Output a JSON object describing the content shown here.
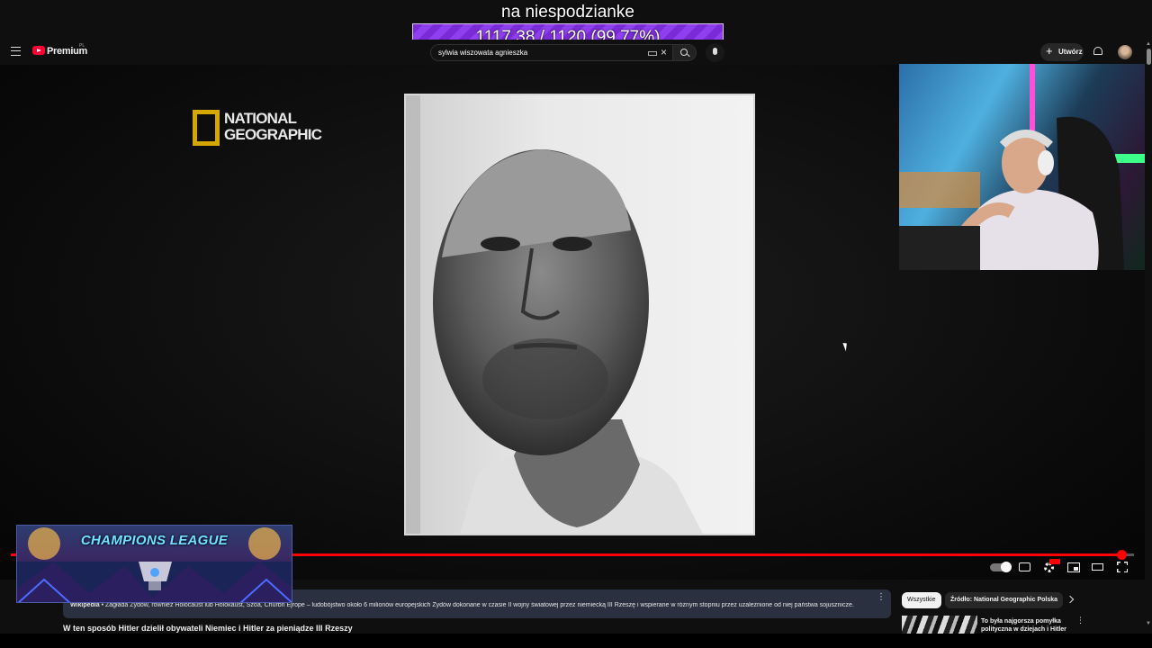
{
  "overlay": {
    "title": "na niespodzianke",
    "goal_text": "1117.38 / 1120 (99.77%)",
    "goal_progress_percent": 99.77,
    "goal_color": "#8f3ff0"
  },
  "header": {
    "brand": "Premium",
    "region": "PL",
    "search_value": "sylwia wiszowata agnieszka",
    "create_label": "Utwórz"
  },
  "video": {
    "watermark": "NATIONAL GEOGRAPHIC",
    "progress_percent": 98.9,
    "progress_color": "#ff0000"
  },
  "champions": {
    "title": "CHAMPIONS LEAGUE"
  },
  "info_panel": {
    "source": "Wikipedia",
    "text": " • Zagłada Żydów, również Holocaust lub Holokaust, Szoa, Churbn Ejrope – ludobójstwo około 6 milionów europejskich Żydów dokonane w czasie II wojny światowej przez niemiecką III Rzeszę i wspierane w różnym stopniu przez uzależnione od niej państwa sojusznicze."
  },
  "video_title": "W ten sposób Hitler dzielił obywateli Niemiec i Hitler za pieniądze III Rzeszy",
  "chips": {
    "all": "Wszystkie",
    "source": "Źródło: National Geographic Polska"
  },
  "suggested": {
    "title": "To była najgorsza pomyłka polityczna w dziejach i Hitler"
  }
}
